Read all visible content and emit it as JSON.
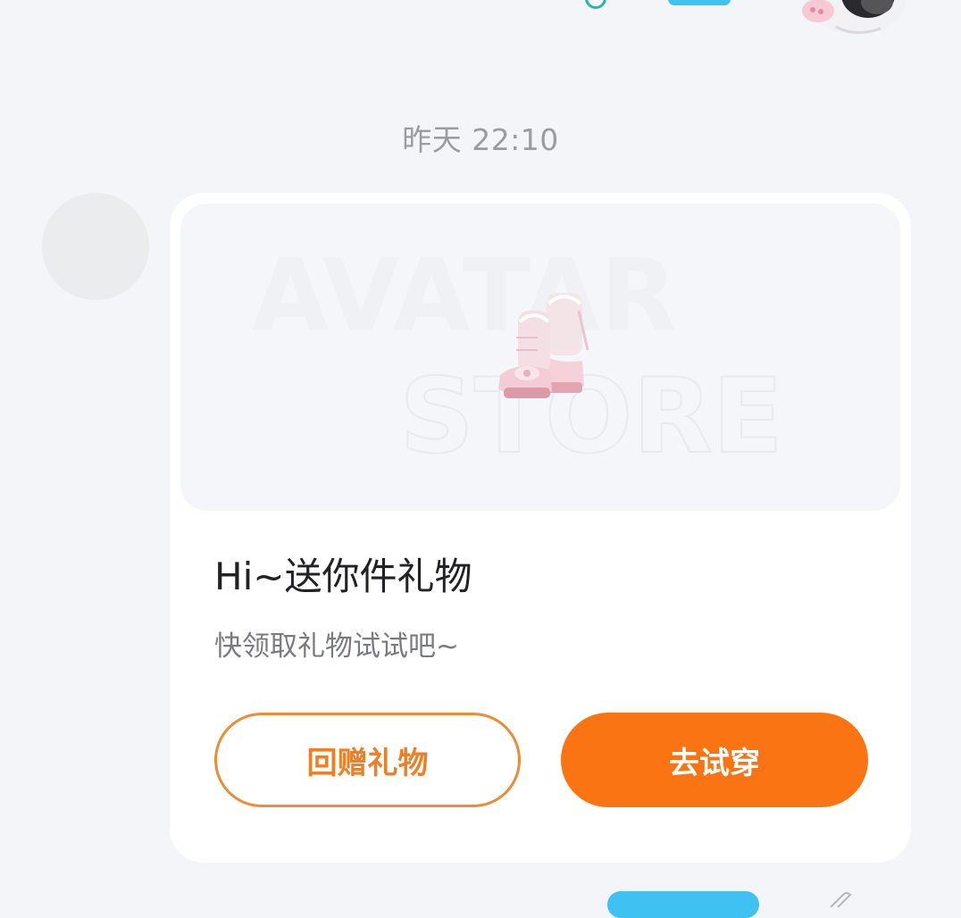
{
  "timestamp": "昨天 22:10",
  "card": {
    "banner_text_line1": "AVATAR",
    "banner_text_line2": "STORE",
    "product_icon": "pink-lolita-boots-icon",
    "title": "Hi~送你件礼物",
    "subtitle": "快领取礼物试试吧~",
    "return_gift_label": "回赠礼物",
    "try_on_label": "去试穿"
  },
  "colors": {
    "background": "#f4f5f9",
    "card": "#ffffff",
    "accent_orange": "#fb7414",
    "outline_orange": "#ef8a35",
    "pill_blue": "#3ec2f0",
    "title_text": "#222226",
    "muted_text": "#9b9ca1"
  }
}
